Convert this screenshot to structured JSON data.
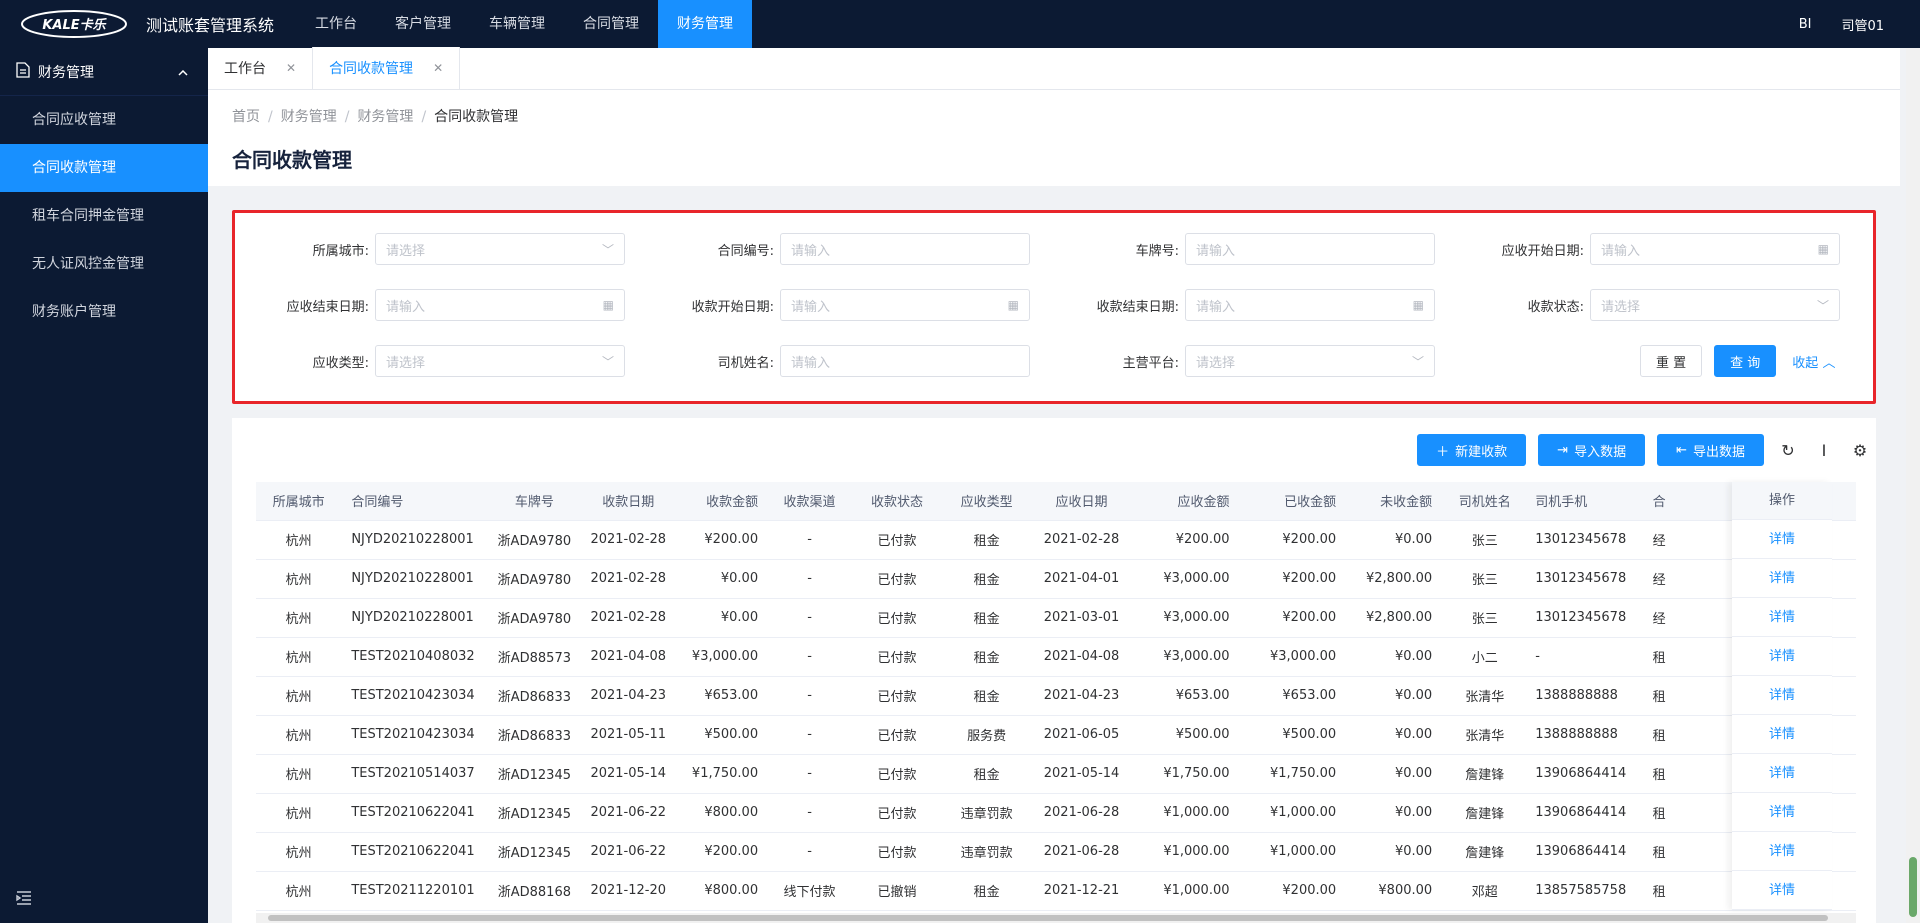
{
  "header": {
    "logo_text": "KALE卡乐",
    "app_title": "测试账套管理系统",
    "nav": [
      "工作台",
      "客户管理",
      "车辆管理",
      "合同管理",
      "财务管理"
    ],
    "active_nav": 4,
    "right_bi": "BI",
    "user": "司管01"
  },
  "sidebar": {
    "group": "财务管理",
    "items": [
      "合同应收管理",
      "合同收款管理",
      "租车合同押金管理",
      "无人证风控金管理",
      "财务账户管理"
    ],
    "active": 1
  },
  "tabs": [
    {
      "label": "工作台"
    },
    {
      "label": "合同收款管理"
    }
  ],
  "breadcrumb": [
    "首页",
    "财务管理",
    "财务管理",
    "合同收款管理"
  ],
  "page_title": "合同收款管理",
  "filters": [
    {
      "label": "所属城市:",
      "placeholder": "请选择",
      "icon": "chevron-down-icon"
    },
    {
      "label": "合同编号:",
      "placeholder": "请输入",
      "icon": ""
    },
    {
      "label": "车牌号:",
      "placeholder": "请输入",
      "icon": ""
    },
    {
      "label": "应收开始日期:",
      "placeholder": "请输入",
      "icon": "calendar-icon"
    },
    {
      "label": "应收结束日期:",
      "placeholder": "请输入",
      "icon": "calendar-icon"
    },
    {
      "label": "收款开始日期:",
      "placeholder": "请输入",
      "icon": "calendar-icon"
    },
    {
      "label": "收款结束日期:",
      "placeholder": "请输入",
      "icon": "calendar-icon"
    },
    {
      "label": "收款状态:",
      "placeholder": "请选择",
      "icon": "chevron-down-icon"
    },
    {
      "label": "应收类型:",
      "placeholder": "请选择",
      "icon": "chevron-down-icon"
    },
    {
      "label": "司机姓名:",
      "placeholder": "请输入",
      "icon": ""
    },
    {
      "label": "主营平台:",
      "placeholder": "请选择",
      "icon": "chevron-down-icon"
    }
  ],
  "filter_buttons": {
    "reset": "重 置",
    "query": "查 询",
    "collapse": "收起"
  },
  "toolbar": {
    "new": "新建收款",
    "import": "导入数据",
    "export": "导出数据"
  },
  "table": {
    "columns": [
      "所属城市",
      "合同编号",
      "车牌号",
      "收款日期",
      "收款金额",
      "收款渠道",
      "收款状态",
      "应收类型",
      "应收日期",
      "应收金额",
      "已收金额",
      "未收金额",
      "司机姓名",
      "司机手机",
      "合"
    ],
    "op_header": "操作",
    "op_label": "详情",
    "rows": [
      [
        "杭州",
        "NJYD20210228001",
        "浙ADA9780",
        "2021-02-28",
        "¥200.00",
        "-",
        "已付款",
        "租金",
        "2021-02-28",
        "¥200.00",
        "¥200.00",
        "¥0.00",
        "张三",
        "13012345678",
        "经"
      ],
      [
        "杭州",
        "NJYD20210228001",
        "浙ADA9780",
        "2021-02-28",
        "¥0.00",
        "-",
        "已付款",
        "租金",
        "2021-04-01",
        "¥3,000.00",
        "¥200.00",
        "¥2,800.00",
        "张三",
        "13012345678",
        "经"
      ],
      [
        "杭州",
        "NJYD20210228001",
        "浙ADA9780",
        "2021-02-28",
        "¥0.00",
        "-",
        "已付款",
        "租金",
        "2021-03-01",
        "¥3,000.00",
        "¥200.00",
        "¥2,800.00",
        "张三",
        "13012345678",
        "经"
      ],
      [
        "杭州",
        "TEST20210408032",
        "浙AD88573",
        "2021-04-08",
        "¥3,000.00",
        "-",
        "已付款",
        "租金",
        "2021-04-08",
        "¥3,000.00",
        "¥3,000.00",
        "¥0.00",
        "小二",
        "-",
        "租"
      ],
      [
        "杭州",
        "TEST20210423034",
        "浙AD86833",
        "2021-04-23",
        "¥653.00",
        "-",
        "已付款",
        "租金",
        "2021-04-23",
        "¥653.00",
        "¥653.00",
        "¥0.00",
        "张清华",
        "1388888888",
        "租"
      ],
      [
        "杭州",
        "TEST20210423034",
        "浙AD86833",
        "2021-05-11",
        "¥500.00",
        "-",
        "已付款",
        "服务费",
        "2021-06-05",
        "¥500.00",
        "¥500.00",
        "¥0.00",
        "张清华",
        "1388888888",
        "租"
      ],
      [
        "杭州",
        "TEST20210514037",
        "浙AD12345",
        "2021-05-14",
        "¥1,750.00",
        "-",
        "已付款",
        "租金",
        "2021-05-14",
        "¥1,750.00",
        "¥1,750.00",
        "¥0.00",
        "詹建锋",
        "13906864414",
        "租"
      ],
      [
        "杭州",
        "TEST20210622041",
        "浙AD12345",
        "2021-06-22",
        "¥800.00",
        "-",
        "已付款",
        "违章罚款",
        "2021-06-28",
        "¥1,000.00",
        "¥1,000.00",
        "¥0.00",
        "詹建锋",
        "13906864414",
        "租"
      ],
      [
        "杭州",
        "TEST20210622041",
        "浙AD12345",
        "2021-06-22",
        "¥200.00",
        "-",
        "已付款",
        "违章罚款",
        "2021-06-28",
        "¥1,000.00",
        "¥1,000.00",
        "¥0.00",
        "詹建锋",
        "13906864414",
        "租"
      ],
      [
        "杭州",
        "TEST20211220101",
        "浙AD88168",
        "2021-12-20",
        "¥800.00",
        "线下付款",
        "已撤销",
        "租金",
        "2021-12-21",
        "¥1,000.00",
        "¥200.00",
        "¥800.00",
        "邓超",
        "13857585758",
        "租"
      ]
    ]
  },
  "colors": {
    "primary": "#1890ff",
    "dark": "#0c1a33",
    "highlight_border": "#e8252a"
  }
}
